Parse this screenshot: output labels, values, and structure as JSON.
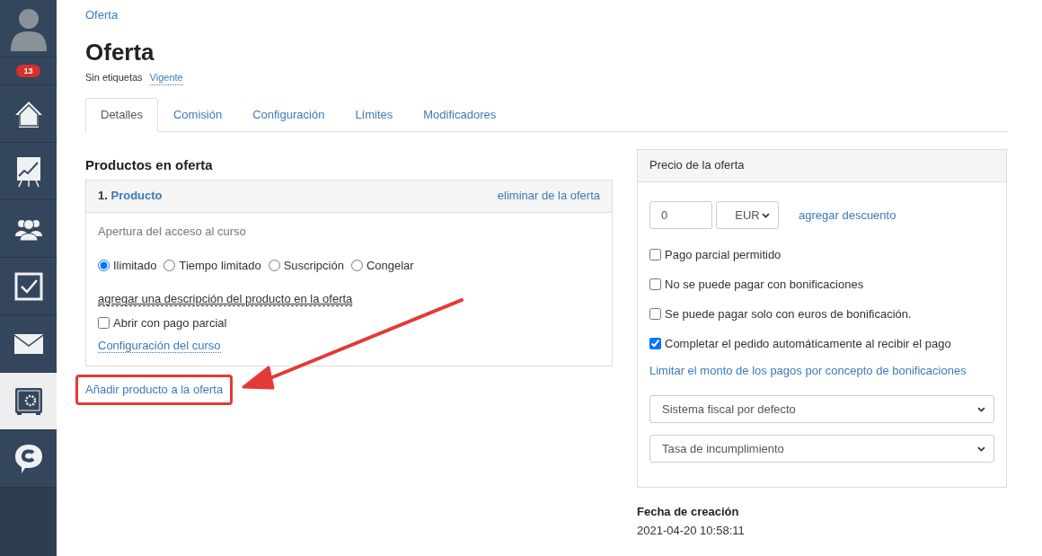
{
  "sidebar": {
    "badge": "13",
    "items": [
      {
        "kind": "home",
        "selected": false
      },
      {
        "kind": "chart",
        "selected": false
      },
      {
        "kind": "people",
        "selected": false
      },
      {
        "kind": "check",
        "selected": false
      },
      {
        "kind": "mail",
        "selected": false
      },
      {
        "kind": "safe",
        "selected": true
      },
      {
        "kind": "chat",
        "selected": false
      }
    ]
  },
  "breadcrumb": "Oferta",
  "title": "Oferta",
  "tags_label": "Sin etiquetas",
  "status_link": "Vigente",
  "tabs": [
    {
      "label": "Detalles",
      "selected": true
    },
    {
      "label": "Comisión",
      "selected": false
    },
    {
      "label": "Configuración",
      "selected": false
    },
    {
      "label": "Límites",
      "selected": false
    },
    {
      "label": "Modificadores",
      "selected": false
    }
  ],
  "products": {
    "heading": "Productos en oferta",
    "items": [
      {
        "number": "1.",
        "name": "Producto",
        "remove_link": "eliminar de la oferta",
        "access_label": "Apertura del acceso al curso",
        "access_options": [
          {
            "label": "Ilimitado",
            "selected": true
          },
          {
            "label": "Tiempo limitado",
            "selected": false
          },
          {
            "label": "Suscripción",
            "selected": false
          },
          {
            "label": "Congelar",
            "selected": false
          }
        ],
        "description_link": "agregar una descripción del producto en la oferta",
        "partial_open": {
          "label": "Abrir con pago parcial",
          "checked": false
        },
        "settings_link": "Configuración del curso"
      }
    ],
    "add_link": "Añadir producto a la oferta"
  },
  "price": {
    "heading": "Precio de la oferta",
    "amount": "0",
    "currency": "EUR",
    "discount_link": "agregar descuento",
    "options": [
      {
        "label": "Pago parcial permitido",
        "checked": false
      },
      {
        "label": "No se puede pagar con bonificaciones",
        "checked": false
      },
      {
        "label": "Se puede pagar solo con euros de bonificación.",
        "checked": false
      },
      {
        "label": "Completar el pedido automáticamente al recibir el pago",
        "checked": true
      }
    ],
    "limit_link": "Limitar el monto de los pagos por concepto de bonificaciones",
    "selects": [
      "Sistema fiscal por defecto",
      "Tasa de incumplimiento"
    ]
  },
  "created": {
    "label": "Fecha de creación",
    "value": "2021-04-20 10:58:11"
  }
}
